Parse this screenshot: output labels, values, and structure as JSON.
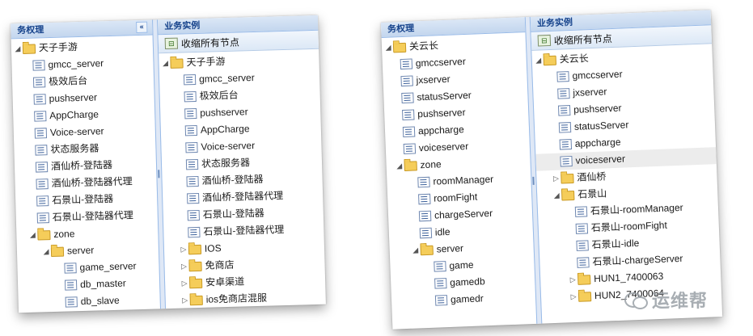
{
  "left_screenshot": {
    "nav_pane": {
      "header": "务权理",
      "root": "天子手游",
      "items": [
        "gmcc_server",
        "极效后台",
        "pushserver",
        "AppCharge",
        "Voice-server",
        "状态服务器",
        "酒仙桥-登陆器",
        "酒仙桥-登陆器代理",
        "石景山-登陆器",
        "石景山-登陆器代理"
      ],
      "zone": "zone",
      "server": "server",
      "server_items": [
        "game_server",
        "db_master",
        "db_slave"
      ]
    },
    "detail_pane": {
      "header": "业务实例",
      "toolbar_label": "收缩所有节点",
      "root": "天子手游",
      "items": [
        "gmcc_server",
        "极效后台",
        "pushserver",
        "AppCharge",
        "Voice-server",
        "状态服务器",
        "酒仙桥-登陆器",
        "酒仙桥-登陆器代理",
        "石景山-登陆器",
        "石景山-登陆器代理"
      ],
      "folders": [
        "IOS",
        "免商店",
        "安卓渠道",
        "ios免商店混服"
      ]
    }
  },
  "right_screenshot": {
    "nav_pane": {
      "header": "务权理",
      "root": "关云长",
      "items": [
        "gmccserver",
        "jxserver",
        "statusServer",
        "pushserver",
        "appcharge",
        "voiceserver"
      ],
      "zone": "zone",
      "zone_items": [
        "roomManager",
        "roomFight",
        "chargeServer",
        "idle"
      ],
      "server": "server",
      "server_items": [
        "game",
        "gamedb",
        "gamedr"
      ]
    },
    "detail_pane": {
      "header": "业务实例",
      "toolbar_label": "收缩所有节点",
      "root": "关云长",
      "items": [
        "gmccserver",
        "jxserver",
        "pushserver",
        "statusServer",
        "appcharge",
        "voiceserver"
      ],
      "folder_a": "酒仙桥",
      "folder_b": "石景山",
      "folder_b_items": [
        "石景山-roomManager",
        "石景山-roomFight",
        "石景山-idle",
        "石景山-chargeServer"
      ],
      "folders_tail": [
        "HUN1_7400063",
        "HUN2_7400064"
      ]
    }
  },
  "watermark": {
    "text": "运维帮",
    "icon": "wechat-icon"
  },
  "colors": {
    "header_bg": "#c3d6ee",
    "header_text": "#15428b",
    "folder": "#f5cd5a",
    "selected_row": "#ececec",
    "watermark": "#9aa0a6"
  }
}
